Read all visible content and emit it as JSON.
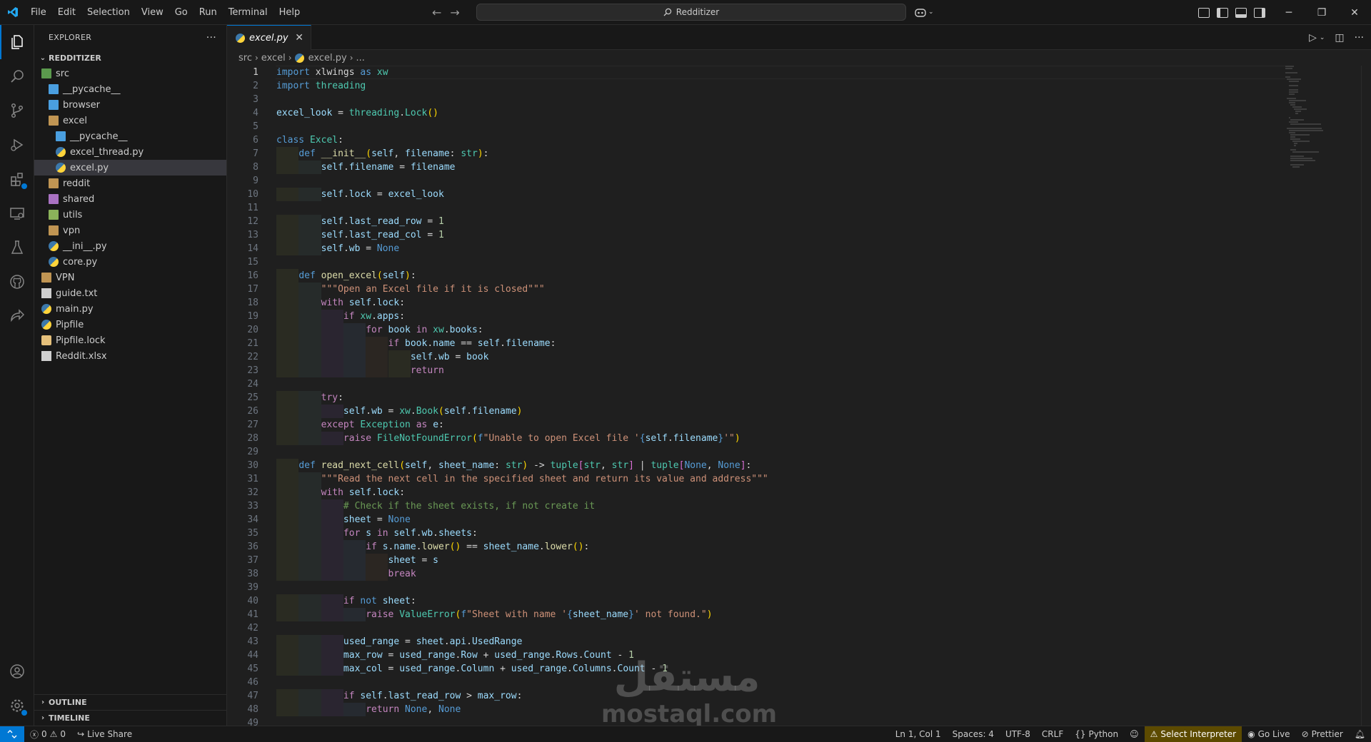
{
  "titlebar": {
    "menu": [
      "File",
      "Edit",
      "Selection",
      "View",
      "Go",
      "Run",
      "Terminal",
      "Help"
    ],
    "search_text": "Redditizer"
  },
  "sidebar": {
    "title": "EXPLORER",
    "project": "REDDITIZER",
    "tree": [
      {
        "label": "src",
        "depth": 0,
        "type": "folder-src"
      },
      {
        "label": "__pycache__",
        "depth": 1,
        "type": "folder-blue"
      },
      {
        "label": "browser",
        "depth": 1,
        "type": "folder-blue"
      },
      {
        "label": "excel",
        "depth": 1,
        "type": "folder"
      },
      {
        "label": "__pycache__",
        "depth": 2,
        "type": "folder-blue"
      },
      {
        "label": "excel_thread.py",
        "depth": 2,
        "type": "py"
      },
      {
        "label": "excel.py",
        "depth": 2,
        "type": "py",
        "selected": true
      },
      {
        "label": "reddit",
        "depth": 1,
        "type": "folder"
      },
      {
        "label": "shared",
        "depth": 1,
        "type": "folder-purple"
      },
      {
        "label": "utils",
        "depth": 1,
        "type": "folder-green"
      },
      {
        "label": "vpn",
        "depth": 1,
        "type": "folder"
      },
      {
        "label": "__ini__.py",
        "depth": 1,
        "type": "py"
      },
      {
        "label": "core.py",
        "depth": 1,
        "type": "py"
      },
      {
        "label": "VPN",
        "depth": 0,
        "type": "folder"
      },
      {
        "label": "guide.txt",
        "depth": 0,
        "type": "txt"
      },
      {
        "label": "main.py",
        "depth": 0,
        "type": "py"
      },
      {
        "label": "Pipfile",
        "depth": 0,
        "type": "py"
      },
      {
        "label": "Pipfile.lock",
        "depth": 0,
        "type": "lock"
      },
      {
        "label": "Reddit.xlsx",
        "depth": 0,
        "type": "xls"
      }
    ],
    "outline": "OUTLINE",
    "timeline": "TIMELINE"
  },
  "editor": {
    "tab": "excel.py",
    "breadcrumb": [
      "src",
      "excel",
      "excel.py",
      "..."
    ],
    "lines": [
      [
        [
          "kw",
          "import"
        ],
        [
          "op",
          " xlwings "
        ],
        [
          "kw",
          "as"
        ],
        [
          "op",
          " "
        ],
        [
          "cl",
          "xw"
        ]
      ],
      [
        [
          "kw",
          "import"
        ],
        [
          "op",
          " "
        ],
        [
          "cl",
          "threading"
        ]
      ],
      [],
      [
        [
          "vr",
          "excel_look"
        ],
        [
          "op",
          " = "
        ],
        [
          "cl",
          "threading"
        ],
        [
          "op",
          "."
        ],
        [
          "cl",
          "Lock"
        ],
        [
          "br",
          "()"
        ]
      ],
      [],
      [
        [
          "kw",
          "class"
        ],
        [
          "op",
          " "
        ],
        [
          "cl",
          "Excel"
        ],
        [
          "op",
          ":"
        ]
      ],
      [
        [
          "op",
          "    "
        ],
        [
          "kw",
          "def"
        ],
        [
          "op",
          " "
        ],
        [
          "fn",
          "__init__"
        ],
        [
          "br",
          "("
        ],
        [
          "vr",
          "self"
        ],
        [
          "op",
          ", "
        ],
        [
          "vr",
          "filename"
        ],
        [
          "op",
          ": "
        ],
        [
          "cl",
          "str"
        ],
        [
          "br",
          ")"
        ],
        [
          "op",
          ":"
        ]
      ],
      [
        [
          "op",
          "        "
        ],
        [
          "vr",
          "self"
        ],
        [
          "op",
          "."
        ],
        [
          "vr",
          "filename"
        ],
        [
          "op",
          " = "
        ],
        [
          "vr",
          "filename"
        ]
      ],
      [],
      [
        [
          "op",
          "        "
        ],
        [
          "vr",
          "self"
        ],
        [
          "op",
          "."
        ],
        [
          "vr",
          "lock"
        ],
        [
          "op",
          " = "
        ],
        [
          "vr",
          "excel_look"
        ]
      ],
      [],
      [
        [
          "op",
          "        "
        ],
        [
          "vr",
          "self"
        ],
        [
          "op",
          "."
        ],
        [
          "vr",
          "last_read_row"
        ],
        [
          "op",
          " = "
        ],
        [
          "nm",
          "1"
        ]
      ],
      [
        [
          "op",
          "        "
        ],
        [
          "vr",
          "self"
        ],
        [
          "op",
          "."
        ],
        [
          "vr",
          "last_read_col"
        ],
        [
          "op",
          " = "
        ],
        [
          "nm",
          "1"
        ]
      ],
      [
        [
          "op",
          "        "
        ],
        [
          "vr",
          "self"
        ],
        [
          "op",
          "."
        ],
        [
          "vr",
          "wb"
        ],
        [
          "op",
          " = "
        ],
        [
          "kw",
          "None"
        ]
      ],
      [],
      [
        [
          "op",
          "    "
        ],
        [
          "kw",
          "def"
        ],
        [
          "op",
          " "
        ],
        [
          "fn",
          "open_excel"
        ],
        [
          "br",
          "("
        ],
        [
          "vr",
          "self"
        ],
        [
          "br",
          ")"
        ],
        [
          "op",
          ":"
        ]
      ],
      [
        [
          "op",
          "        "
        ],
        [
          "st",
          "\"\"\"Open an Excel file if it is closed\"\"\""
        ]
      ],
      [
        [
          "op",
          "        "
        ],
        [
          "kc",
          "with"
        ],
        [
          "op",
          " "
        ],
        [
          "vr",
          "self"
        ],
        [
          "op",
          "."
        ],
        [
          "vr",
          "lock"
        ],
        [
          "op",
          ":"
        ]
      ],
      [
        [
          "op",
          "            "
        ],
        [
          "kc",
          "if"
        ],
        [
          "op",
          " "
        ],
        [
          "cl",
          "xw"
        ],
        [
          "op",
          "."
        ],
        [
          "vr",
          "apps"
        ],
        [
          "op",
          ":"
        ]
      ],
      [
        [
          "op",
          "                "
        ],
        [
          "kc",
          "for"
        ],
        [
          "op",
          " "
        ],
        [
          "vr",
          "book"
        ],
        [
          "op",
          " "
        ],
        [
          "kc",
          "in"
        ],
        [
          "op",
          " "
        ],
        [
          "cl",
          "xw"
        ],
        [
          "op",
          "."
        ],
        [
          "vr",
          "books"
        ],
        [
          "op",
          ":"
        ]
      ],
      [
        [
          "op",
          "                    "
        ],
        [
          "kc",
          "if"
        ],
        [
          "op",
          " "
        ],
        [
          "vr",
          "book"
        ],
        [
          "op",
          "."
        ],
        [
          "vr",
          "name"
        ],
        [
          "op",
          " == "
        ],
        [
          "vr",
          "self"
        ],
        [
          "op",
          "."
        ],
        [
          "vr",
          "filename"
        ],
        [
          "op",
          ":"
        ]
      ],
      [
        [
          "op",
          "                        "
        ],
        [
          "vr",
          "self"
        ],
        [
          "op",
          "."
        ],
        [
          "vr",
          "wb"
        ],
        [
          "op",
          " = "
        ],
        [
          "vr",
          "book"
        ]
      ],
      [
        [
          "op",
          "                        "
        ],
        [
          "kc",
          "return"
        ]
      ],
      [],
      [
        [
          "op",
          "        "
        ],
        [
          "kc",
          "try"
        ],
        [
          "op",
          ":"
        ]
      ],
      [
        [
          "op",
          "            "
        ],
        [
          "vr",
          "self"
        ],
        [
          "op",
          "."
        ],
        [
          "vr",
          "wb"
        ],
        [
          "op",
          " = "
        ],
        [
          "cl",
          "xw"
        ],
        [
          "op",
          "."
        ],
        [
          "cl",
          "Book"
        ],
        [
          "br",
          "("
        ],
        [
          "vr",
          "self"
        ],
        [
          "op",
          "."
        ],
        [
          "vr",
          "filename"
        ],
        [
          "br",
          ")"
        ]
      ],
      [
        [
          "op",
          "        "
        ],
        [
          "kc",
          "except"
        ],
        [
          "op",
          " "
        ],
        [
          "cl",
          "Exception"
        ],
        [
          "op",
          " "
        ],
        [
          "kc",
          "as"
        ],
        [
          "op",
          " "
        ],
        [
          "vr",
          "e"
        ],
        [
          "op",
          ":"
        ]
      ],
      [
        [
          "op",
          "            "
        ],
        [
          "kc",
          "raise"
        ],
        [
          "op",
          " "
        ],
        [
          "cl",
          "FileNotFoundError"
        ],
        [
          "br",
          "("
        ],
        [
          "kw",
          "f"
        ],
        [
          "st",
          "\"Unable to open Excel file '"
        ],
        [
          "kw",
          "{"
        ],
        [
          "vr",
          "self"
        ],
        [
          "op",
          "."
        ],
        [
          "vr",
          "filename"
        ],
        [
          "kw",
          "}"
        ],
        [
          "st",
          "'\""
        ],
        [
          "br",
          ")"
        ]
      ],
      [],
      [
        [
          "op",
          "    "
        ],
        [
          "kw",
          "def"
        ],
        [
          "op",
          " "
        ],
        [
          "fn",
          "read_next_cell"
        ],
        [
          "br",
          "("
        ],
        [
          "vr",
          "self"
        ],
        [
          "op",
          ", "
        ],
        [
          "vr",
          "sheet_name"
        ],
        [
          "op",
          ": "
        ],
        [
          "cl",
          "str"
        ],
        [
          "br",
          ")"
        ],
        [
          "op",
          " -> "
        ],
        [
          "cl",
          "tuple"
        ],
        [
          "br2",
          "["
        ],
        [
          "cl",
          "str"
        ],
        [
          "op",
          ", "
        ],
        [
          "cl",
          "str"
        ],
        [
          "br2",
          "]"
        ],
        [
          "op",
          " | "
        ],
        [
          "cl",
          "tuple"
        ],
        [
          "br2",
          "["
        ],
        [
          "kw",
          "None"
        ],
        [
          "op",
          ", "
        ],
        [
          "kw",
          "None"
        ],
        [
          "br2",
          "]"
        ],
        [
          "op",
          ":"
        ]
      ],
      [
        [
          "op",
          "        "
        ],
        [
          "st",
          "\"\"\"Read the next cell in the specified sheet and return its value and address\"\"\""
        ]
      ],
      [
        [
          "op",
          "        "
        ],
        [
          "kc",
          "with"
        ],
        [
          "op",
          " "
        ],
        [
          "vr",
          "self"
        ],
        [
          "op",
          "."
        ],
        [
          "vr",
          "lock"
        ],
        [
          "op",
          ":"
        ]
      ],
      [
        [
          "op",
          "            "
        ],
        [
          "cm",
          "# Check if the sheet exists, if not create it"
        ]
      ],
      [
        [
          "op",
          "            "
        ],
        [
          "vr",
          "sheet"
        ],
        [
          "op",
          " = "
        ],
        [
          "kw",
          "None"
        ]
      ],
      [
        [
          "op",
          "            "
        ],
        [
          "kc",
          "for"
        ],
        [
          "op",
          " "
        ],
        [
          "vr",
          "s"
        ],
        [
          "op",
          " "
        ],
        [
          "kc",
          "in"
        ],
        [
          "op",
          " "
        ],
        [
          "vr",
          "self"
        ],
        [
          "op",
          "."
        ],
        [
          "vr",
          "wb"
        ],
        [
          "op",
          "."
        ],
        [
          "vr",
          "sheets"
        ],
        [
          "op",
          ":"
        ]
      ],
      [
        [
          "op",
          "                "
        ],
        [
          "kc",
          "if"
        ],
        [
          "op",
          " "
        ],
        [
          "vr",
          "s"
        ],
        [
          "op",
          "."
        ],
        [
          "vr",
          "name"
        ],
        [
          "op",
          "."
        ],
        [
          "fn",
          "lower"
        ],
        [
          "br",
          "()"
        ],
        [
          "op",
          " == "
        ],
        [
          "vr",
          "sheet_name"
        ],
        [
          "op",
          "."
        ],
        [
          "fn",
          "lower"
        ],
        [
          "br",
          "()"
        ],
        [
          "op",
          ":"
        ]
      ],
      [
        [
          "op",
          "                    "
        ],
        [
          "vr",
          "sheet"
        ],
        [
          "op",
          " = "
        ],
        [
          "vr",
          "s"
        ]
      ],
      [
        [
          "op",
          "                    "
        ],
        [
          "kc",
          "break"
        ]
      ],
      [],
      [
        [
          "op",
          "            "
        ],
        [
          "kc",
          "if"
        ],
        [
          "op",
          " "
        ],
        [
          "kw",
          "not"
        ],
        [
          "op",
          " "
        ],
        [
          "vr",
          "sheet"
        ],
        [
          "op",
          ":"
        ]
      ],
      [
        [
          "op",
          "                "
        ],
        [
          "kc",
          "raise"
        ],
        [
          "op",
          " "
        ],
        [
          "cl",
          "ValueError"
        ],
        [
          "br",
          "("
        ],
        [
          "kw",
          "f"
        ],
        [
          "st",
          "\"Sheet with name '"
        ],
        [
          "kw",
          "{"
        ],
        [
          "vr",
          "sheet_name"
        ],
        [
          "kw",
          "}"
        ],
        [
          "st",
          "' not found.\""
        ],
        [
          "br",
          ")"
        ]
      ],
      [],
      [
        [
          "op",
          "            "
        ],
        [
          "vr",
          "used_range"
        ],
        [
          "op",
          " = "
        ],
        [
          "vr",
          "sheet"
        ],
        [
          "op",
          "."
        ],
        [
          "vr",
          "api"
        ],
        [
          "op",
          "."
        ],
        [
          "vr",
          "UsedRange"
        ]
      ],
      [
        [
          "op",
          "            "
        ],
        [
          "vr",
          "max_row"
        ],
        [
          "op",
          " = "
        ],
        [
          "vr",
          "used_range"
        ],
        [
          "op",
          "."
        ],
        [
          "vr",
          "Row"
        ],
        [
          "op",
          " + "
        ],
        [
          "vr",
          "used_range"
        ],
        [
          "op",
          "."
        ],
        [
          "vr",
          "Rows"
        ],
        [
          "op",
          "."
        ],
        [
          "vr",
          "Count"
        ],
        [
          "op",
          " - "
        ],
        [
          "nm",
          "1"
        ]
      ],
      [
        [
          "op",
          "            "
        ],
        [
          "vr",
          "max_col"
        ],
        [
          "op",
          " = "
        ],
        [
          "vr",
          "used_range"
        ],
        [
          "op",
          "."
        ],
        [
          "vr",
          "Column"
        ],
        [
          "op",
          " + "
        ],
        [
          "vr",
          "used_range"
        ],
        [
          "op",
          "."
        ],
        [
          "vr",
          "Columns"
        ],
        [
          "op",
          "."
        ],
        [
          "vr",
          "Count"
        ],
        [
          "op",
          " - "
        ],
        [
          "nm",
          "1"
        ]
      ],
      [],
      [
        [
          "op",
          "            "
        ],
        [
          "kc",
          "if"
        ],
        [
          "op",
          " "
        ],
        [
          "vr",
          "self"
        ],
        [
          "op",
          "."
        ],
        [
          "vr",
          "last_read_row"
        ],
        [
          "op",
          " > "
        ],
        [
          "vr",
          "max_row"
        ],
        [
          "op",
          ":"
        ]
      ],
      [
        [
          "op",
          "                "
        ],
        [
          "kc",
          "return"
        ],
        [
          "op",
          " "
        ],
        [
          "kw",
          "None"
        ],
        [
          "op",
          ", "
        ],
        [
          "kw",
          "None"
        ]
      ],
      []
    ]
  },
  "watermark": {
    "arabic": "مستقل",
    "latin": "mostaql.com"
  },
  "statusbar": {
    "errors": "0",
    "warnings": "0",
    "live_share": "Live Share",
    "position": "Ln 1, Col 1",
    "spaces": "Spaces: 4",
    "encoding": "UTF-8",
    "eol": "CRLF",
    "language": "Python",
    "interpreter": "Select Interpreter",
    "go_live": "Go Live",
    "prettier": "Prettier"
  }
}
